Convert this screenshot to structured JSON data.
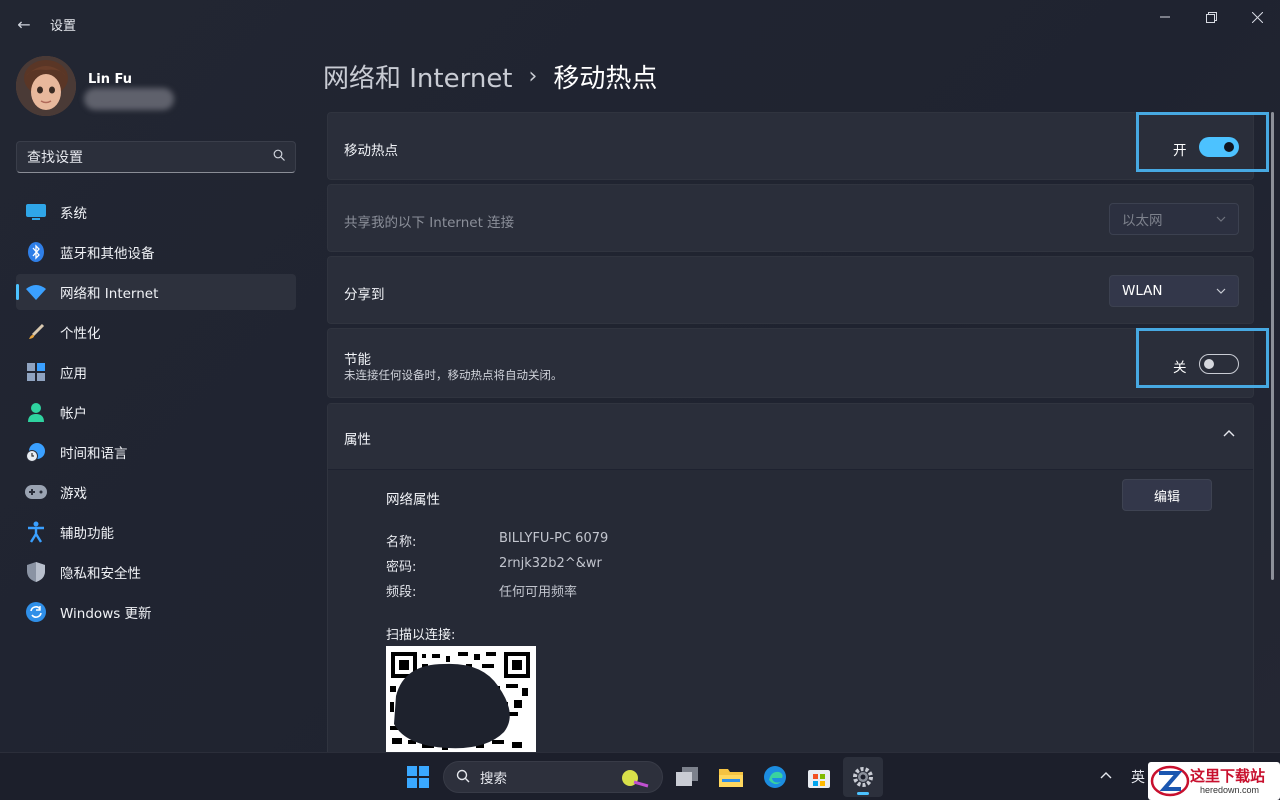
{
  "window": {
    "app_title": "设置",
    "back_icon": "arrow-left-icon",
    "controls": [
      "minimize-icon",
      "maximize-icon",
      "close-icon"
    ]
  },
  "profile": {
    "name": "Lin Fu"
  },
  "search": {
    "placeholder": "查找设置",
    "icon": "search-icon"
  },
  "sidebar": {
    "items": [
      {
        "label": "系统",
        "icon": "monitor-icon",
        "active": false
      },
      {
        "label": "蓝牙和其他设备",
        "icon": "bluetooth-icon",
        "active": false
      },
      {
        "label": "网络和 Internet",
        "icon": "wifi-icon",
        "active": true
      },
      {
        "label": "个性化",
        "icon": "brush-icon",
        "active": false
      },
      {
        "label": "应用",
        "icon": "apps-icon",
        "active": false
      },
      {
        "label": "帐户",
        "icon": "person-icon",
        "active": false
      },
      {
        "label": "时间和语言",
        "icon": "clock-globe-icon",
        "active": false
      },
      {
        "label": "游戏",
        "icon": "gamepad-icon",
        "active": false
      },
      {
        "label": "辅助功能",
        "icon": "accessibility-icon",
        "active": false
      },
      {
        "label": "隐私和安全性",
        "icon": "shield-icon",
        "active": false
      },
      {
        "label": "Windows 更新",
        "icon": "refresh-icon",
        "active": false
      }
    ]
  },
  "breadcrumb": {
    "parent": "网络和 Internet",
    "separator": "›",
    "current": "移动热点"
  },
  "hotspot": {
    "label": "移动热点",
    "state_text": "开",
    "on": true
  },
  "share_from": {
    "label": "共享我的以下 Internet 连接",
    "value": "以太网",
    "disabled": true
  },
  "share_to": {
    "label": "分享到",
    "value": "WLAN"
  },
  "power_saving": {
    "label": "节能",
    "description": "未连接任何设备时，移动热点将自动关闭。",
    "state_text": "关",
    "on": false
  },
  "properties": {
    "title": "属性",
    "network_props_title": "网络属性",
    "edit_label": "编辑",
    "rows": [
      {
        "key": "名称:",
        "value": "BILLYFU-PC 6079"
      },
      {
        "key": "密码:",
        "value": "2rnjk32b2^&wr"
      },
      {
        "key": "频段:",
        "value": "任何可用频率"
      }
    ],
    "scan_label": "扫描以连接:"
  },
  "taskbar": {
    "search_label": "搜索",
    "lang": "英",
    "apps": [
      "windows-start-icon",
      "task-view-icon",
      "file-explorer-icon",
      "edge-icon",
      "store-icon",
      "settings-icon"
    ]
  },
  "watermark": {
    "text": "这里下载站",
    "sub": "heredown.com"
  },
  "colors": {
    "accent": "#4cc2ff",
    "highlight_box": "#47a9e2"
  }
}
